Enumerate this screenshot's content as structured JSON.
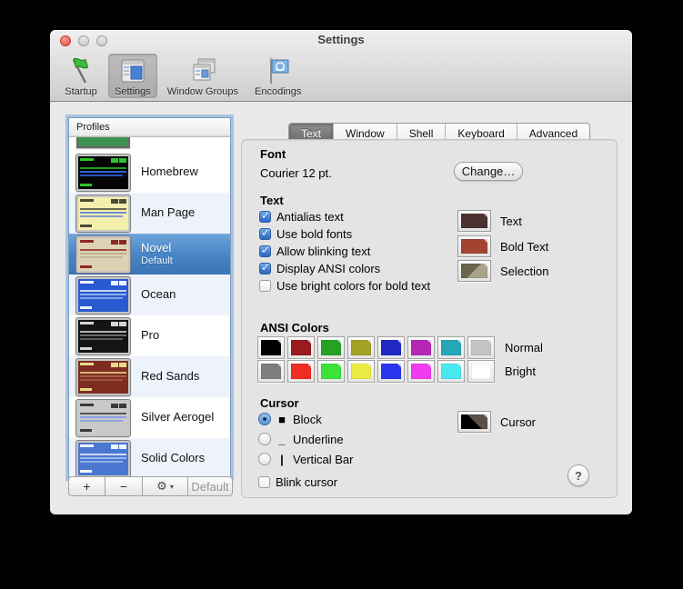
{
  "window": {
    "title": "Settings"
  },
  "toolbar": {
    "items": [
      {
        "label": "Startup",
        "selected": false
      },
      {
        "label": "Settings",
        "selected": true
      },
      {
        "label": "Window Groups",
        "selected": false
      },
      {
        "label": "Encodings",
        "selected": false
      }
    ]
  },
  "profiles": {
    "header": "Profiles",
    "partial": {
      "thumb": {
        "bg": "#3f9150",
        "fg": "#3f9150",
        "hl": "#3f9150"
      }
    },
    "items": [
      {
        "name": "Homebrew",
        "selected": false,
        "thumb": {
          "bg": "#050505",
          "fg": "#2bc62b",
          "hl": "#2b62d8"
        }
      },
      {
        "name": "Man Page",
        "selected": false,
        "thumb": {
          "bg": "#f5efad",
          "fg": "#4a4a3a",
          "hl": "#6b8fd8"
        }
      },
      {
        "name": "Novel",
        "subtitle": "Default",
        "selected": true,
        "thumb": {
          "bg": "#ddd2b4",
          "fg": "#8a2a22",
          "hl": "#bfb193"
        }
      },
      {
        "name": "Ocean",
        "selected": false,
        "thumb": {
          "bg": "#2a5ad2",
          "fg": "#eef2fa",
          "hl": "#8fb0ea"
        }
      },
      {
        "name": "Pro",
        "selected": false,
        "thumb": {
          "bg": "#141414",
          "fg": "#d6d6d6",
          "hl": "#6a6a6a"
        }
      },
      {
        "name": "Red Sands",
        "selected": false,
        "thumb": {
          "bg": "#7c2d20",
          "fg": "#ecd98a",
          "hl": "#a85a48"
        }
      },
      {
        "name": "Silver Aerogel",
        "selected": false,
        "thumb": {
          "bg": "#c9c9c9",
          "fg": "#3a3a3a",
          "hl": "#8aa0e0"
        }
      },
      {
        "name": "Solid Colors",
        "selected": false,
        "thumb": {
          "bg": "#4a77cf",
          "fg": "#f0f4ff",
          "hl": "#9ab6ee"
        }
      }
    ],
    "footer": {
      "add": "+",
      "remove": "−",
      "gear": "⚙",
      "dropdown": "▾",
      "default_label": "Default"
    }
  },
  "tabs": {
    "items": [
      {
        "label": "Text",
        "selected": true
      },
      {
        "label": "Window",
        "selected": false
      },
      {
        "label": "Shell",
        "selected": false
      },
      {
        "label": "Keyboard",
        "selected": false
      },
      {
        "label": "Advanced",
        "selected": false
      }
    ]
  },
  "panel": {
    "font": {
      "heading": "Font",
      "value": "Courier 12 pt.",
      "change_label": "Change…"
    },
    "text": {
      "heading": "Text",
      "checkboxes": [
        {
          "label": "Antialias text",
          "checked": true
        },
        {
          "label": "Use bold fonts",
          "checked": true
        },
        {
          "label": "Allow blinking text",
          "checked": true
        },
        {
          "label": "Display ANSI colors",
          "checked": true
        },
        {
          "label": "Use bright colors for bold text",
          "checked": false
        }
      ],
      "wells": [
        {
          "label": "Text",
          "color": "#4b3231"
        },
        {
          "label": "Bold Text",
          "color": "#a34433"
        },
        {
          "label": "Selection",
          "dark": "#6b644f",
          "light": "#a8a48a",
          "angle": "135deg"
        }
      ]
    },
    "ansi": {
      "heading": "ANSI Colors",
      "normal": {
        "label": "Normal",
        "colors": [
          "#010101",
          "#991b1e",
          "#26a226",
          "#a2a327",
          "#1f27c4",
          "#b627b6",
          "#27a7b5",
          "#c4c4c4"
        ]
      },
      "bright": {
        "label": "Bright",
        "colors": [
          "#7e7e7e",
          "#ef2d24",
          "#3ae23a",
          "#eceb43",
          "#2b35f0",
          "#f03cf0",
          "#49e9f0",
          "#ffffff"
        ]
      }
    },
    "cursor": {
      "heading": "Cursor",
      "radios": [
        {
          "label": "Block",
          "glyph": "■",
          "selected": true
        },
        {
          "label": "Underline",
          "glyph": "_",
          "selected": false
        },
        {
          "label": "Vertical Bar",
          "glyph": "|",
          "selected": false
        }
      ],
      "well": {
        "label": "Cursor",
        "dark": "#000000",
        "light": "#5b4f47",
        "angle": "45deg"
      },
      "blink": {
        "label": "Blink cursor",
        "checked": false
      }
    },
    "help": "?"
  },
  "icons": {
    "check": "✓"
  }
}
